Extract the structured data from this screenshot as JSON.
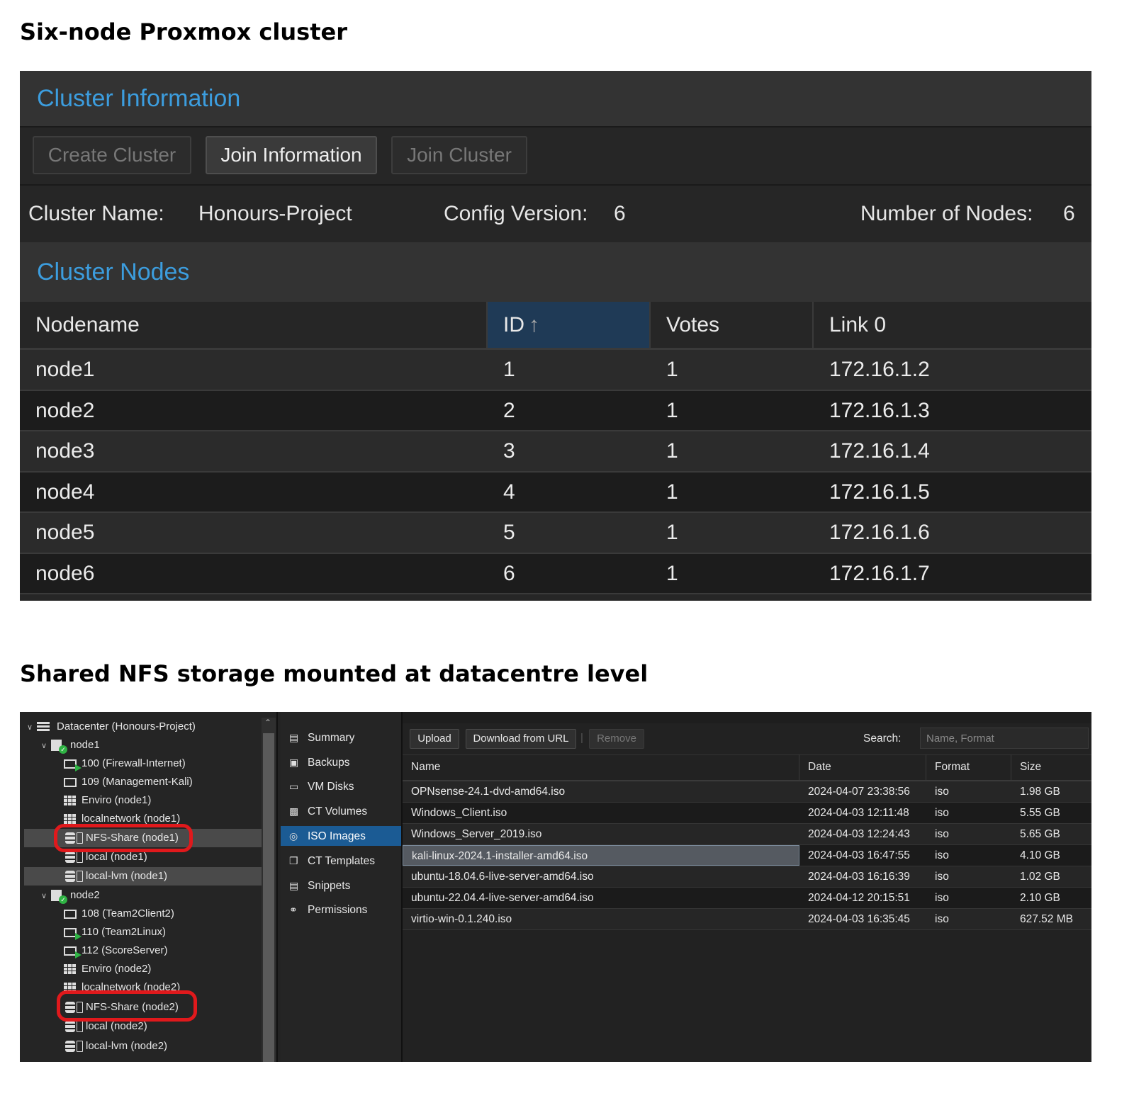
{
  "headings": {
    "cluster": "Six-node Proxmox cluster",
    "storage": "Shared NFS storage mounted at datacentre level"
  },
  "cluster_panel": {
    "title": "Cluster Information",
    "buttons": {
      "create": "Create Cluster",
      "join_information": "Join Information",
      "join": "Join Cluster"
    },
    "info": {
      "name_label": "Cluster Name:",
      "name_value": "Honours-Project",
      "config_label": "Config Version:",
      "config_value": "6",
      "nodes_label": "Number of Nodes:",
      "nodes_value": "6"
    },
    "nodes_title": "Cluster Nodes",
    "columns": {
      "nodename": "Nodename",
      "id": "ID",
      "id_sort": "↑",
      "votes": "Votes",
      "link": "Link 0"
    },
    "rows": [
      {
        "name": "node1",
        "id": "1",
        "votes": "1",
        "link": "172.16.1.2"
      },
      {
        "name": "node2",
        "id": "2",
        "votes": "1",
        "link": "172.16.1.3"
      },
      {
        "name": "node3",
        "id": "3",
        "votes": "1",
        "link": "172.16.1.4"
      },
      {
        "name": "node4",
        "id": "4",
        "votes": "1",
        "link": "172.16.1.5"
      },
      {
        "name": "node5",
        "id": "5",
        "votes": "1",
        "link": "172.16.1.6"
      },
      {
        "name": "node6",
        "id": "6",
        "votes": "1",
        "link": "172.16.1.7"
      }
    ]
  },
  "storage_panel": {
    "tree": {
      "datacenter": "Datacenter (Honours-Project)",
      "node1": "node1",
      "node1_items": {
        "vm100": "100 (Firewall-Internet)",
        "vm109": "109 (Management-Kali)",
        "enviro": "Enviro (node1)",
        "localnetwork": "localnetwork (node1)",
        "nfs": "NFS-Share (node1)",
        "local": "local (node1)",
        "locallvm": "local-lvm (node1)"
      },
      "node2": "node2",
      "node2_items": {
        "vm108": "108 (Team2Client2)",
        "vm110": "110 (Team2Linux)",
        "vm112": "112 (ScoreServer)",
        "enviro": "Enviro (node2)",
        "localnetwork": "localnetwork (node2)",
        "nfs": "NFS-Share (node2)",
        "local": "local (node2)",
        "locallvm": "local-lvm (node2)"
      }
    },
    "menu": {
      "summary": "Summary",
      "backups": "Backups",
      "vm_disks": "VM Disks",
      "ct_volumes": "CT Volumes",
      "iso_images": "ISO Images",
      "ct_templates": "CT Templates",
      "snippets": "Snippets",
      "permissions": "Permissions"
    },
    "toolbar": {
      "upload": "Upload",
      "download_url": "Download from URL",
      "separator": "|",
      "remove": "Remove",
      "search_label": "Search:",
      "search_placeholder": "Name, Format"
    },
    "columns": {
      "name": "Name",
      "date": "Date",
      "format": "Format",
      "size": "Size"
    },
    "files": [
      {
        "name": "OPNsense-24.1-dvd-amd64.iso",
        "date": "2024-04-07 23:38:56",
        "format": "iso",
        "size": "1.98 GB"
      },
      {
        "name": "Windows_Client.iso",
        "date": "2024-04-03 12:11:48",
        "format": "iso",
        "size": "5.55 GB"
      },
      {
        "name": "Windows_Server_2019.iso",
        "date": "2024-04-03 12:24:43",
        "format": "iso",
        "size": "5.65 GB"
      },
      {
        "name": "kali-linux-2024.1-installer-amd64.iso",
        "date": "2024-04-03 16:47:55",
        "format": "iso",
        "size": "4.10 GB"
      },
      {
        "name": "ubuntu-18.04.6-live-server-amd64.iso",
        "date": "2024-04-03 16:16:39",
        "format": "iso",
        "size": "1.02 GB"
      },
      {
        "name": "ubuntu-22.04.4-live-server-amd64.iso",
        "date": "2024-04-12 20:15:51",
        "format": "iso",
        "size": "2.10 GB"
      },
      {
        "name": "virtio-win-0.1.240.iso",
        "date": "2024-04-03 16:35:45",
        "format": "iso",
        "size": "627.52 MB"
      }
    ],
    "colors": {
      "accent": "#1b5b94",
      "title_blue": "#3c9dde",
      "highlight_red": "#e0191c",
      "running_green": "#2fb344"
    }
  }
}
